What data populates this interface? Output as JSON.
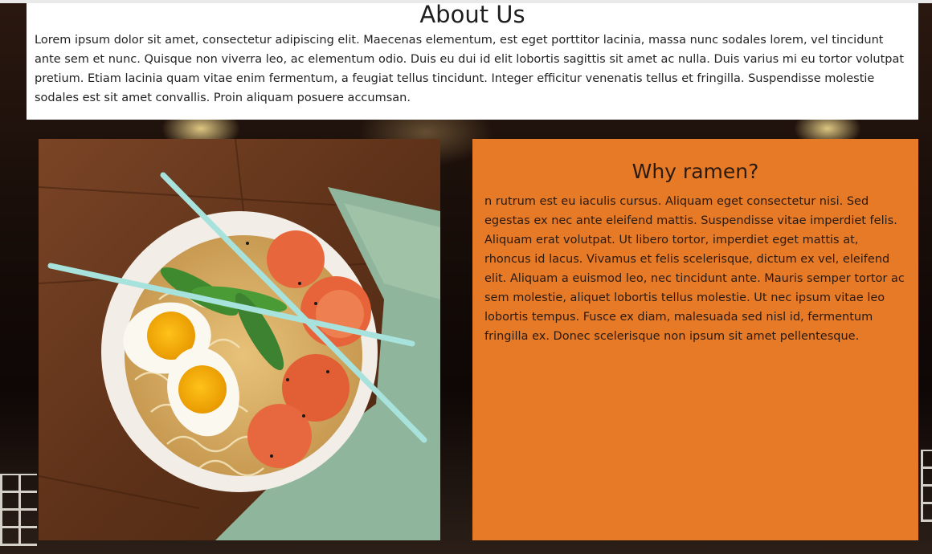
{
  "about": {
    "title": "About Us",
    "body": "Lorem ipsum dolor sit amet, consectetur adipiscing elit. Maecenas elementum, est eget porttitor lacinia, massa nunc sodales lorem, vel tincidunt ante sem et nunc. Quisque non viverra leo, ac elementum odio. Duis eu dui id elit lobortis sagittis sit amet ac nulla. Duis varius mi eu tortor volutpat pretium. Etiam lacinia quam vitae enim fermentum, a feugiat tellus tincidunt. Integer efficitur venenatis tellus et fringilla. Suspendisse molestie sodales est sit amet convallis. Proin aliquam posuere accumsan."
  },
  "why": {
    "title": "Why ramen?",
    "body": "n rutrum est eu iaculis cursus. Aliquam eget consectetur nisi. Sed egestas ex nec ante eleifend mattis. Suspendisse vitae imperdiet felis. Aliquam erat volutpat. Ut libero tortor, imperdiet eget mattis at, rhoncus id lacus. Vivamus et felis scelerisque, dictum ex vel, eleifend elit. Aliquam a euismod leo, nec tincidunt ante. Mauris semper tortor ac sem molestie, aliquet lobortis tellus molestie. Ut nec ipsum vitae leo lobortis tempus. Fusce ex diam, malesuada sed nisl id, fermentum fringilla ex. Donec scelerisque non ipsum sit amet pellentesque."
  },
  "colors": {
    "accent_panel": "#e77a27",
    "content_panel": "#ffffff"
  }
}
